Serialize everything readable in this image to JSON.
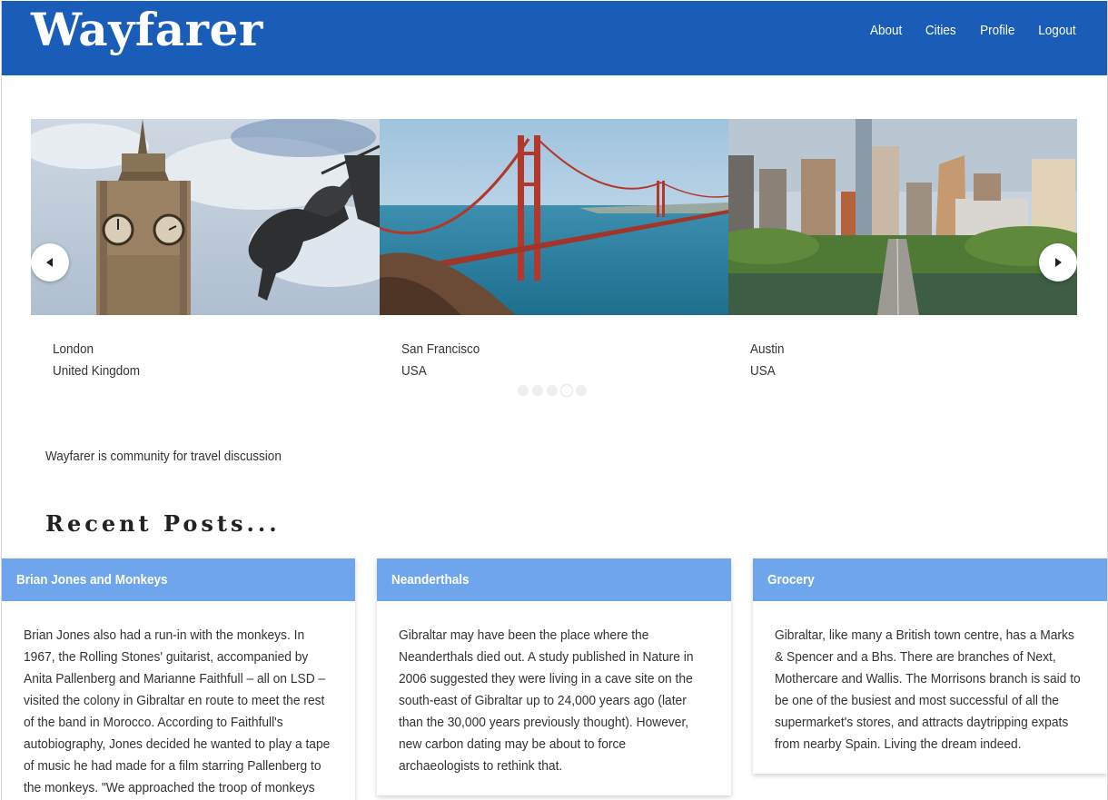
{
  "header": {
    "brand": "Wayfarer",
    "nav": [
      {
        "label": "About"
      },
      {
        "label": "Cities"
      },
      {
        "label": "Profile"
      },
      {
        "label": "Logout"
      }
    ]
  },
  "carousel": {
    "slides": [
      {
        "city": "London",
        "country": "United Kingdom"
      },
      {
        "city": "San Francisco",
        "country": "USA"
      },
      {
        "city": "Austin",
        "country": "USA"
      }
    ],
    "dot_count": 5,
    "active_dot": 4
  },
  "tagline": "Wayfarer is community for travel discussion",
  "recent_posts": {
    "title": "Recent Posts...",
    "posts": [
      {
        "title": "Brian Jones and Monkeys",
        "body": "Brian Jones also had a run-in with the monkeys. In 1967, the Rolling Stones' guitarist, accompanied by Anita Pallenberg and Marianne Faithfull – all on LSD – visited the colony in Gibraltar en route to meet the rest of the band in Morocco. According to Faithfull's autobiography, Jones decided he wanted to play a tape of music he had made for a film starring Pallenberg to the monkeys. \"We approached the troop of monkeys very ceremoniously,\""
      },
      {
        "title": "Neanderthals",
        "body": "Gibraltar may have been the place where the Neanderthals died out. A study published in Nature in 2006 suggested they were living in a cave site on the south-east of Gibraltar up to 24,000 years ago (later than the 30,000 years previously thought). However, new carbon dating may be about to force archaeologists to rethink that."
      },
      {
        "title": "Grocery",
        "body": "Gibraltar, like many a British town centre, has a Marks & Spencer and a Bhs. There are branches of Next, Mothercare and Wallis. The Morrisons branch is said to be one of the busiest and most successful of all the supermarket's stores, and attracts daytripping expats from nearby Spain. Living the dream indeed."
      }
    ]
  },
  "colors": {
    "navbar": "#1a5db8",
    "card_header": "#6fa5ec"
  }
}
